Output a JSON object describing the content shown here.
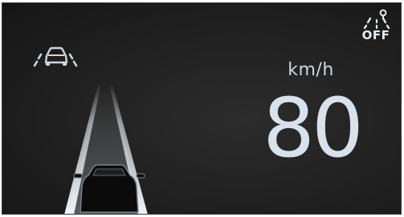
{
  "cluster": {
    "speed": {
      "unit": "km/h",
      "value": "80"
    },
    "lane_assist": {
      "icon": "lane-keeping-assist-icon",
      "color": "#cfd6dc"
    },
    "driver_assist_status": {
      "icon": "highway-driving-assist-icon",
      "state_label": "OFF"
    }
  }
}
